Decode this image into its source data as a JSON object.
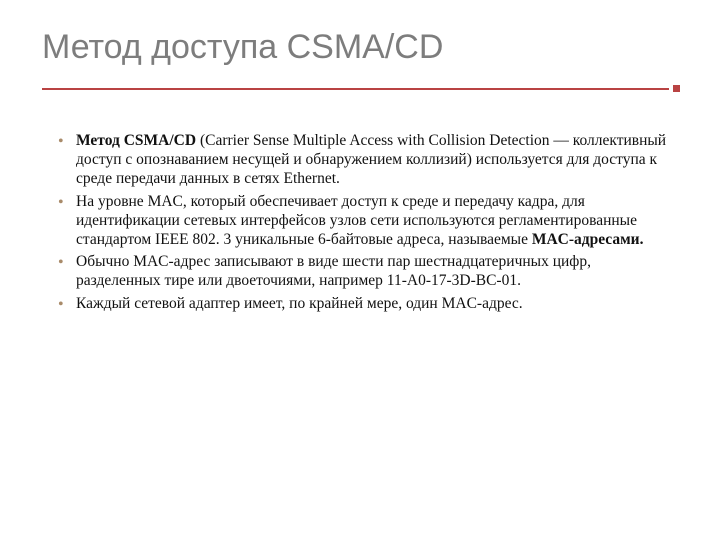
{
  "title": "Метод доступа CSMA/CD",
  "bullets": [
    {
      "lead_bold": "Метод CSMA/CD ",
      "rest_a": "(Carrier Sense Multiple Access with Collision Detection — коллективный доступ с опознаванием несущей и обнаружением коллизий) используется для доступа к среде передачи данных в сетях Ethernet.",
      "mid_bold": "",
      "rest_b": ""
    },
    {
      "lead_bold": "",
      "rest_a": "На уровне MAC, который обеспечивает доступ к среде и передачу кадра, для идентификации сетевых интерфейсов узлов сети используются регламентированные стандартом IEEE 802. 3 уникальные 6-байтовые адреса, называемые ",
      "mid_bold": "MAC-адресами.",
      "rest_b": ""
    },
    {
      "lead_bold": "",
      "rest_a": "Обычно MAC-адрес записывают в виде шести пар шестнадцатеричных цифр, разделенных тире или двоеточиями, например 11-A0-17-3D-BC-01.",
      "mid_bold": "",
      "rest_b": ""
    },
    {
      "lead_bold": "",
      "rest_a": "Каждый сетевой адаптер имеет, по крайней мере, один MAC-адрес.",
      "mid_bold": "",
      "rest_b": ""
    }
  ]
}
